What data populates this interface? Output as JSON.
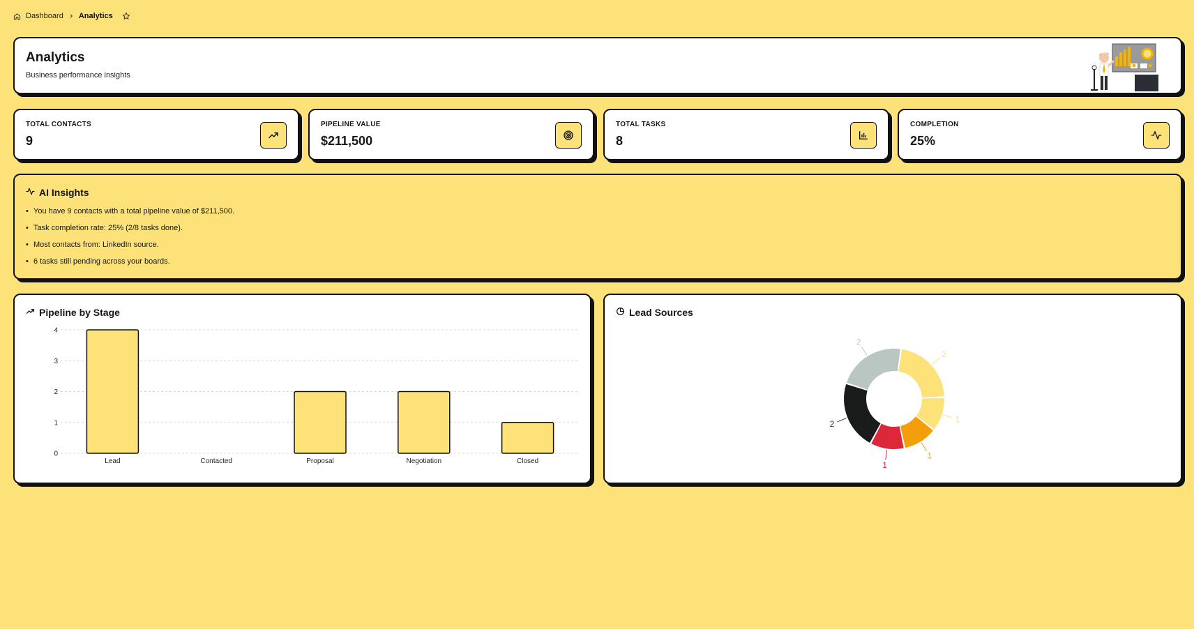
{
  "breadcrumb": {
    "home": "Dashboard",
    "current": "Analytics"
  },
  "hero": {
    "title": "Analytics",
    "subtitle": "Business performance insights"
  },
  "stats": [
    {
      "label": "TOTAL CONTACTS",
      "value": "9",
      "icon": "trending-up-icon"
    },
    {
      "label": "PIPELINE VALUE",
      "value": "$211,500",
      "icon": "target-icon"
    },
    {
      "label": "TOTAL TASKS",
      "value": "8",
      "icon": "bar-chart-icon"
    },
    {
      "label": "COMPLETION",
      "value": "25%",
      "icon": "activity-icon"
    }
  ],
  "insights": {
    "title": "AI Insights",
    "items": [
      "You have 9 contacts with a total pipeline value of $211,500.",
      "Task completion rate: 25% (2/8 tasks done).",
      "Most contacts from: LinkedIn source.",
      "6 tasks still pending across your boards."
    ]
  },
  "pipeline": {
    "title": "Pipeline by Stage"
  },
  "lead_sources": {
    "title": "Lead Sources"
  },
  "colors": {
    "background": "#FDE27A",
    "accent": "#FDE27A",
    "border": "#111111"
  },
  "chart_data": [
    {
      "type": "bar",
      "title": "Pipeline by Stage",
      "categories": [
        "Lead",
        "Contacted",
        "Proposal",
        "Negotiation",
        "Closed"
      ],
      "values": [
        4,
        0,
        2,
        2,
        1
      ],
      "yticks": [
        0,
        1,
        2,
        3,
        4
      ],
      "ylim": [
        0,
        4
      ],
      "grid": true,
      "bar_color": "#FDE27A"
    },
    {
      "type": "pie",
      "title": "Lead Sources",
      "donut": true,
      "slices": [
        {
          "value": 2,
          "label": "2",
          "color": "#FDE27A"
        },
        {
          "value": 1,
          "label": "1",
          "color": "#FDE27A"
        },
        {
          "value": 1,
          "label": "1",
          "color": "#F59E0B"
        },
        {
          "value": 1,
          "label": "1",
          "color": "#DC2838"
        },
        {
          "value": 2,
          "label": "2",
          "color": "#1A1C1C"
        },
        {
          "value": 2,
          "label": "2",
          "color": "#B9C6C2"
        }
      ]
    }
  ]
}
